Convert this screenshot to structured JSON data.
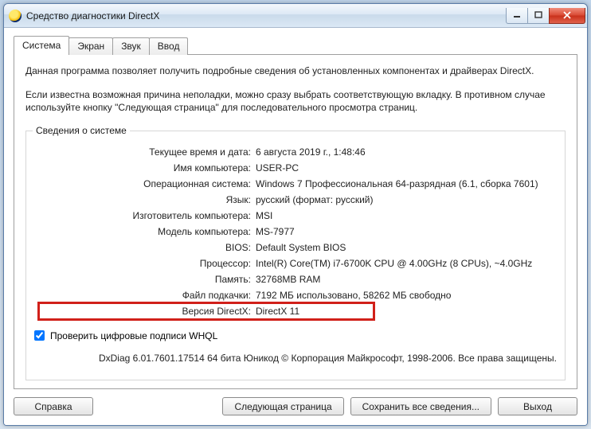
{
  "window": {
    "title": "Средство диагностики DirectX"
  },
  "tabs": {
    "t0": "Система",
    "t1": "Экран",
    "t2": "Звук",
    "t3": "Ввод"
  },
  "intro": {
    "p1": "Данная программа позволяет получить подробные сведения об установленных компонентах и драйверах DirectX.",
    "p2": "Если известна возможная причина неполадки, можно сразу выбрать соответствующую вкладку. В противном случае используйте кнопку \"Следующая страница\" для последовательного просмотра страниц."
  },
  "group": {
    "legend": "Сведения о системе",
    "rows": {
      "datetime": {
        "label": "Текущее время и дата:",
        "value": "6 августа 2019 г., 1:48:46"
      },
      "pcname": {
        "label": "Имя компьютера:",
        "value": "USER-PC"
      },
      "os": {
        "label": "Операционная система:",
        "value": "Windows 7 Профессиональная 64-разрядная (6.1, сборка 7601)"
      },
      "lang": {
        "label": "Язык:",
        "value": "русский (формат: русский)"
      },
      "oem": {
        "label": "Изготовитель компьютера:",
        "value": "MSI"
      },
      "model": {
        "label": "Модель компьютера:",
        "value": "MS-7977"
      },
      "bios": {
        "label": "BIOS:",
        "value": "Default System BIOS"
      },
      "cpu": {
        "label": "Процессор:",
        "value": "Intel(R) Core(TM) i7-6700K CPU @ 4.00GHz (8 CPUs), ~4.0GHz"
      },
      "ram": {
        "label": "Память:",
        "value": "32768MB RAM"
      },
      "pagefile": {
        "label": "Файл подкачки:",
        "value": "7192 МБ использовано, 58262 МБ свободно"
      },
      "dx": {
        "label": "Версия DirectX:",
        "value": "DirectX 11"
      }
    },
    "whql_label": "Проверить цифровые подписи WHQL",
    "footer": "DxDiag 6.01.7601.17514 64 бита Юникод  © Корпорация Майкрософт, 1998-2006.  Все права защищены."
  },
  "buttons": {
    "help": "Справка",
    "next": "Следующая страница",
    "save": "Сохранить все сведения...",
    "exit": "Выход"
  }
}
